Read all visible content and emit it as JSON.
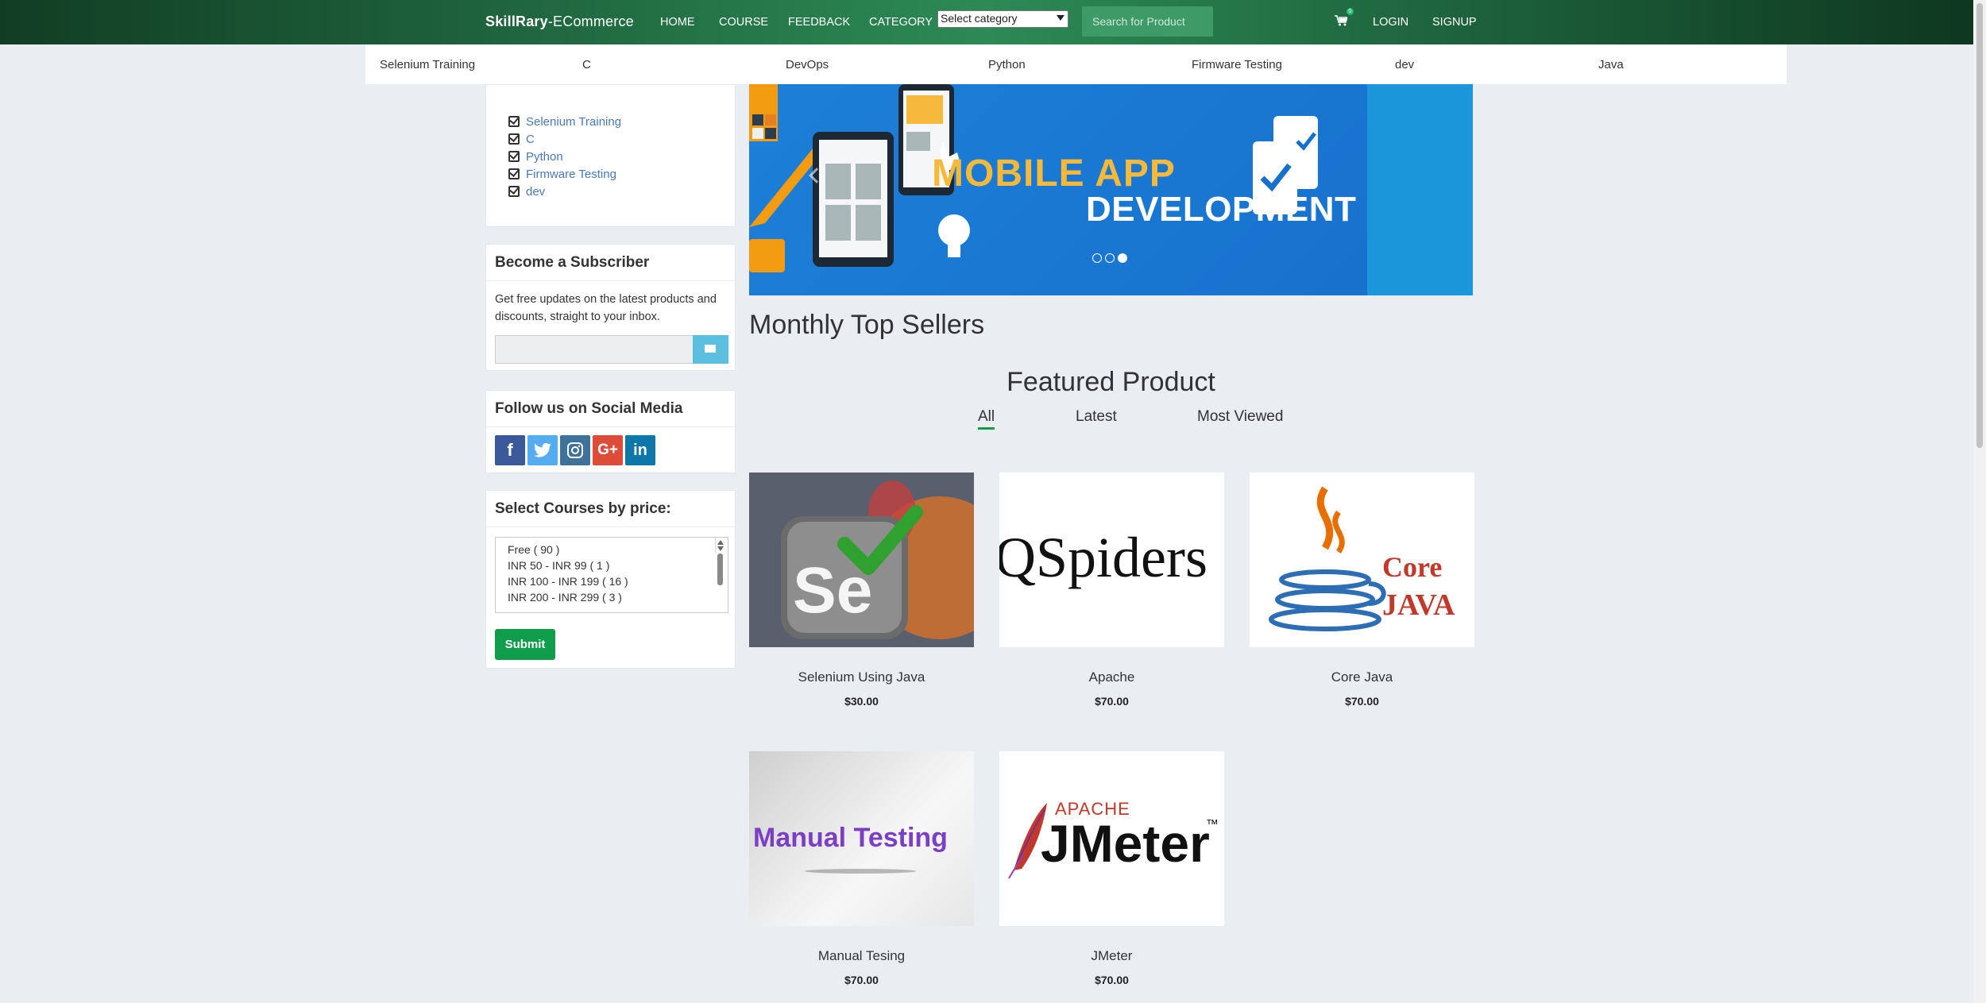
{
  "navbar": {
    "brand_bold": "SkillRary",
    "brand_rest": "-ECommerce",
    "links": {
      "home": "HOME",
      "course": "COURSE",
      "feedback": "FEEDBACK",
      "category": "CATEGORY",
      "login": "LOGIN",
      "signup": "SIGNUP"
    },
    "category_select": "Select category",
    "search_placeholder": "Search for Product",
    "cart_count": "0",
    "bg_color": "#2c8a55"
  },
  "category_bar": [
    "Selenium Training",
    "C",
    "DevOps",
    "Python",
    "Firmware Testing",
    "dev",
    "Java"
  ],
  "sidebar": {
    "categories": [
      "Selenium Training",
      "C",
      "Python",
      "Firmware Testing",
      "dev"
    ],
    "subscriber": {
      "title": "Become a Subscriber",
      "text": "Get free updates on the latest products and discounts, straight to your inbox.",
      "email_value": ""
    },
    "social": {
      "title": "Follow us on Social Media",
      "icons": [
        "facebook-icon",
        "twitter-icon",
        "instagram-icon",
        "google-plus-icon",
        "linkedin-icon"
      ]
    },
    "price": {
      "title": "Select Courses by price:",
      "options": [
        "Free ( 90 )",
        "INR 50 - INR 99 ( 1 )",
        "INR 100 - INR 199 ( 16 )",
        "INR 200 - INR 299 ( 3 )"
      ],
      "submit": "Submit"
    }
  },
  "banner": {
    "line1": "MOBILE APP",
    "line2": "DEVELOPMENT",
    "active_slide": 3,
    "slide_count": 3
  },
  "main": {
    "monthly_title": "Monthly Top Sellers",
    "featured_title": "Featured Product",
    "tabs": [
      "All",
      "Latest",
      "Most Viewed"
    ],
    "active_tab": "All",
    "products": [
      {
        "name": "Selenium Using Java",
        "price": "$30.00",
        "logo": "Se"
      },
      {
        "name": "Apache",
        "price": "$70.00",
        "logo": "QSpiders"
      },
      {
        "name": "Core Java",
        "price": "$70.00",
        "logo_l1": "Core",
        "logo_l2": "JAVA"
      },
      {
        "name": "Manual Tesing",
        "price": "$70.00",
        "logo": "Manual Testing"
      },
      {
        "name": "JMeter",
        "price": "$70.00",
        "logo_top": "APACHE",
        "logo": "JMeter",
        "logo_tm": "™"
      }
    ]
  }
}
